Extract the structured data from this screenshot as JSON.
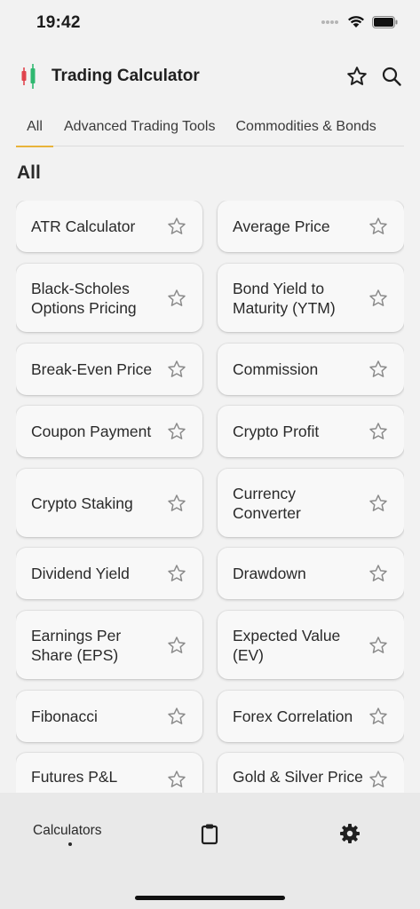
{
  "status_bar": {
    "time": "19:42"
  },
  "header": {
    "title": "Trading Calculator",
    "favorites_icon": "star-icon",
    "search_icon": "search-icon"
  },
  "tabs": [
    {
      "label": "All",
      "selected": true
    },
    {
      "label": "Advanced Trading Tools",
      "selected": false
    },
    {
      "label": "Commodities & Bonds",
      "selected": false
    }
  ],
  "section": {
    "title": "All"
  },
  "calculators": [
    {
      "label": "ATR Calculator"
    },
    {
      "label": "Average Price"
    },
    {
      "label": "Black-Scholes Options Pricing"
    },
    {
      "label": "Bond Yield to Maturity (YTM)"
    },
    {
      "label": "Break-Even Price"
    },
    {
      "label": "Commission"
    },
    {
      "label": "Coupon Payment"
    },
    {
      "label": "Crypto Profit"
    },
    {
      "label": "Crypto Staking"
    },
    {
      "label": "Currency Converter"
    },
    {
      "label": "Dividend Yield"
    },
    {
      "label": "Drawdown"
    },
    {
      "label": "Earnings Per Share (EPS)"
    },
    {
      "label": "Expected Value (EV)"
    },
    {
      "label": "Fibonacci"
    },
    {
      "label": "Forex Correlation"
    },
    {
      "label": "Futures P&L"
    },
    {
      "label": "Gold & Silver Price"
    }
  ],
  "bottom_nav": {
    "calculators_label": "Calculators",
    "clipboard_icon": "clipboard-icon",
    "settings_icon": "gear-icon"
  },
  "colors": {
    "accent": "#e8b33a",
    "logo_red": "#e0444e",
    "logo_green": "#2fb870"
  }
}
